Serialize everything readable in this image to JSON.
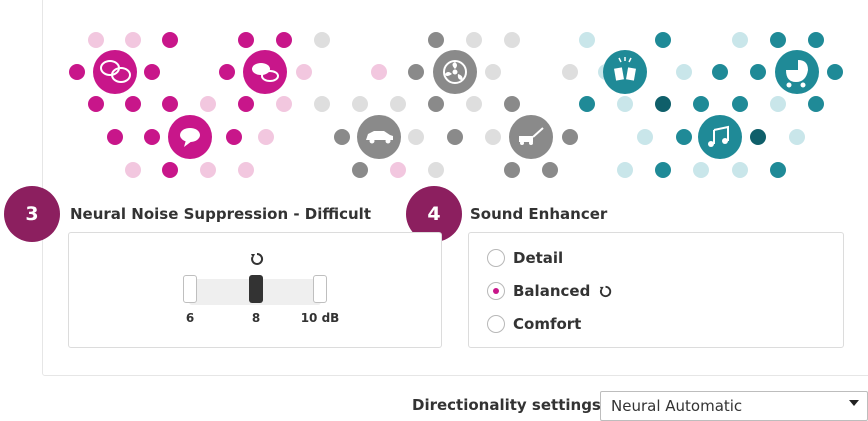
{
  "steps": {
    "noise": "3",
    "sound": "4"
  },
  "noise_section": {
    "title": "Neural Noise Suppression - Difficult",
    "ticks": [
      "6",
      "8",
      "10 dB"
    ],
    "current_value_db": 8
  },
  "sound_section": {
    "title": "Sound Enhancer",
    "options": [
      {
        "label": "Detail",
        "checked": false
      },
      {
        "label": "Balanced",
        "checked": true
      },
      {
        "label": "Comfort",
        "checked": false
      }
    ]
  },
  "directionality": {
    "label": "Directionality settings",
    "value": "Neural Automatic"
  },
  "environment_icons": [
    "crowd-speech-icon",
    "chat-bubbles-icon",
    "speech-bubble-icon",
    "fan-icon",
    "car-icon",
    "lawnmower-icon",
    "toast-glasses-icon",
    "stroller-icon",
    "music-note-icon"
  ],
  "colors": {
    "magenta": "#c8168a",
    "magenta_light": "#f2c7df",
    "gray": "#8a8a8a",
    "gray_light": "#dedede",
    "teal": "#1f8a97",
    "teal_light": "#c9e6ea",
    "badge": "#8c1f5f"
  }
}
